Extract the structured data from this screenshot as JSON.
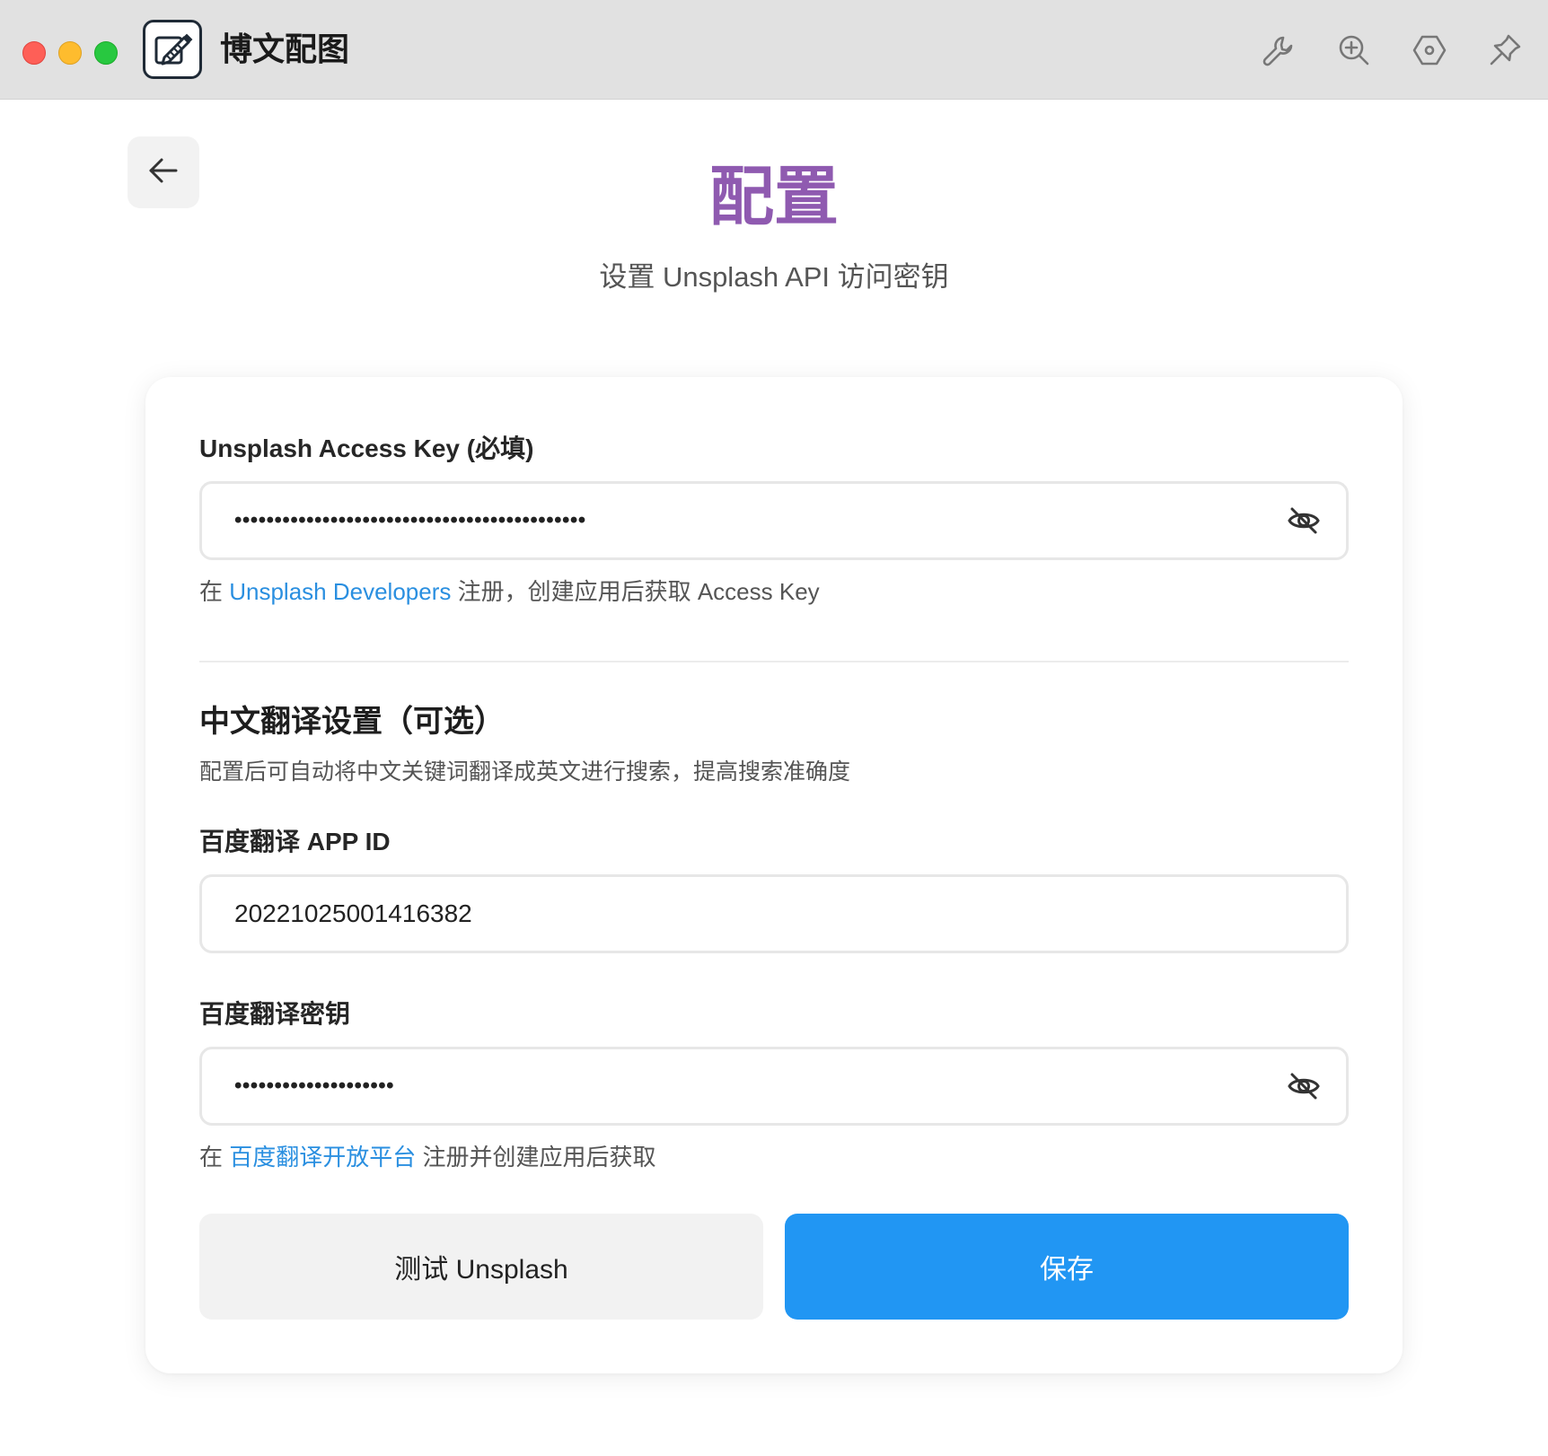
{
  "window": {
    "app_title": "博文配图",
    "toolbar_icons": [
      "wrench-icon",
      "zoom-in-icon",
      "hexagon-settings-icon",
      "pin-icon"
    ]
  },
  "header": {
    "back_icon": "arrow-left-icon",
    "title": "配置",
    "subtitle": "设置 Unsplash API 访问密钥"
  },
  "unsplash": {
    "label": "Unsplash Access Key (必填)",
    "value_masked": "••••••••••••••••••••••••••••••••••••••••••••",
    "hint_prefix": "在 ",
    "hint_link": "Unsplash Developers",
    "hint_suffix": " 注册，创建应用后获取 Access Key"
  },
  "translation": {
    "section_title": "中文翻译设置（可选）",
    "section_desc": "配置后可自动将中文关键词翻译成英文进行搜索，提高搜索准确度",
    "app_id_label": "百度翻译 APP ID",
    "app_id_value": "20221025001416382",
    "secret_label": "百度翻译密钥",
    "secret_masked": "••••••••••••••••••••",
    "hint_prefix": "在 ",
    "hint_link": "百度翻译开放平台",
    "hint_suffix": " 注册并创建应用后获取"
  },
  "actions": {
    "test_label": "测试 Unsplash",
    "save_label": "保存"
  },
  "colors": {
    "title": "#8f5ab0",
    "link": "#2a8fe0",
    "primary": "#2196f3"
  }
}
